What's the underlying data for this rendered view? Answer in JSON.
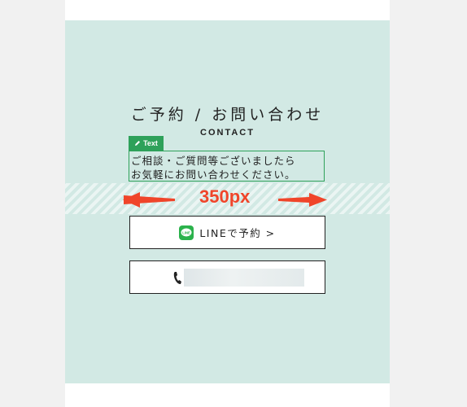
{
  "contact_section": {
    "title": "ご予約 / お問い合わせ",
    "subtitle": "CONTACT"
  },
  "editor": {
    "text_tag_label": "Text",
    "text_tag_icon": "pencil-icon",
    "text_lines": [
      "ご相談・ご質問等ございましたら",
      "お気軽にお問い合わせください。"
    ]
  },
  "measurement": {
    "label": "350px",
    "color": "#f0452a"
  },
  "buttons": {
    "line_label": "LINEで予約 >",
    "line_icon": "line-app-icon",
    "line_icon_text": "LINE",
    "tel_icon": "phone-icon"
  },
  "colors": {
    "section_bg": "#d2e9e4",
    "editor_green": "#2ea15a",
    "line_green": "#2bb24c"
  }
}
